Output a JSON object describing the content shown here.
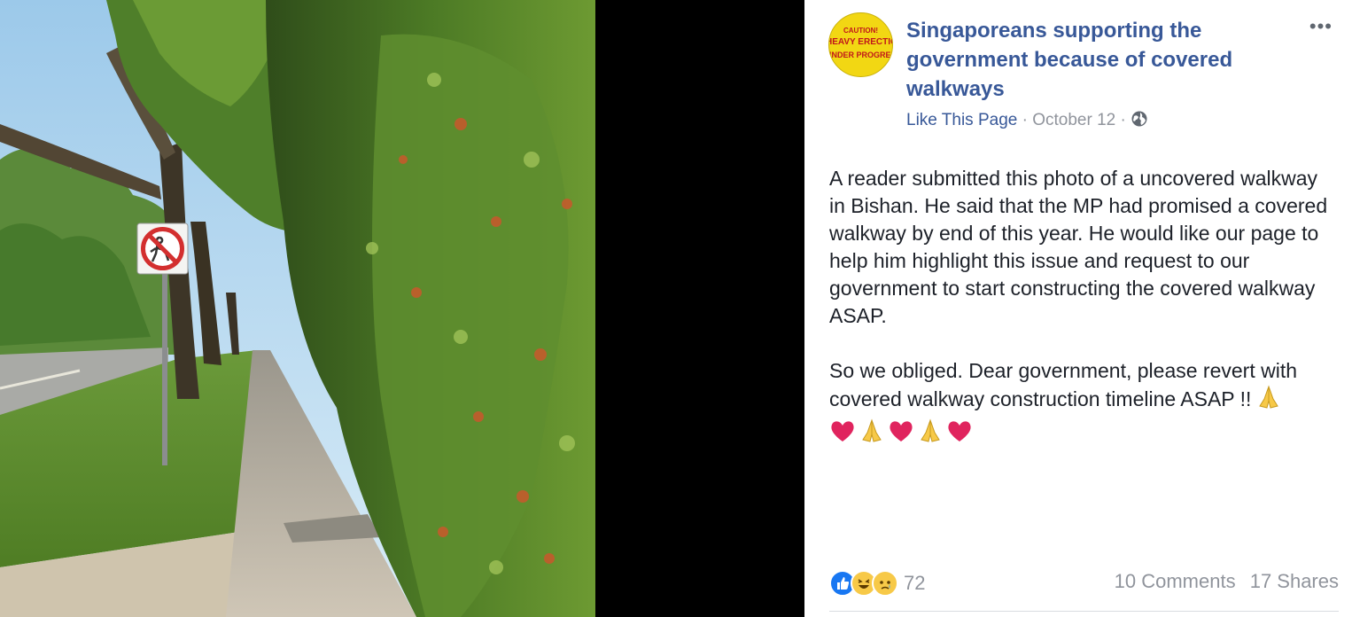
{
  "page": {
    "name": "Singaporeans supporting the government because of covered walkways",
    "avatar_sign": [
      "CAUTION!",
      "HEAVY ERECTION",
      "UNDER PROGRESS"
    ],
    "like_label": "Like This Page",
    "separator": "·",
    "date": "October 12",
    "more_label": "•••"
  },
  "post": {
    "paragraph1": "A reader submitted this photo of a uncovered walkway in Bishan. He said that the MP had promised a covered walkway by end of this year. He would like our page to help him highlight this issue and request to our government to start constructing the covered walkway ASAP.",
    "paragraph2": "So we obliged. Dear government, please revert with covered walkway construction timeline ASAP !!",
    "emojis": [
      "folded-hands",
      "heart",
      "folded-hands",
      "heart",
      "folded-hands",
      "heart"
    ]
  },
  "footer": {
    "reactions": [
      "like",
      "haha",
      "sad"
    ],
    "reaction_count": "72",
    "comments": "10 Comments",
    "shares": "17 Shares"
  },
  "colors": {
    "link_blue": "#385898",
    "meta_gray": "#90949c",
    "text": "#1d2129",
    "like_blue": "#1877f2",
    "reaction_yellow": "#f7c948",
    "heart_red": "#e0245e"
  },
  "icons": {
    "globe": "globe-icon",
    "more": "more-options-icon",
    "sign": "no-pedestrian-sign"
  }
}
